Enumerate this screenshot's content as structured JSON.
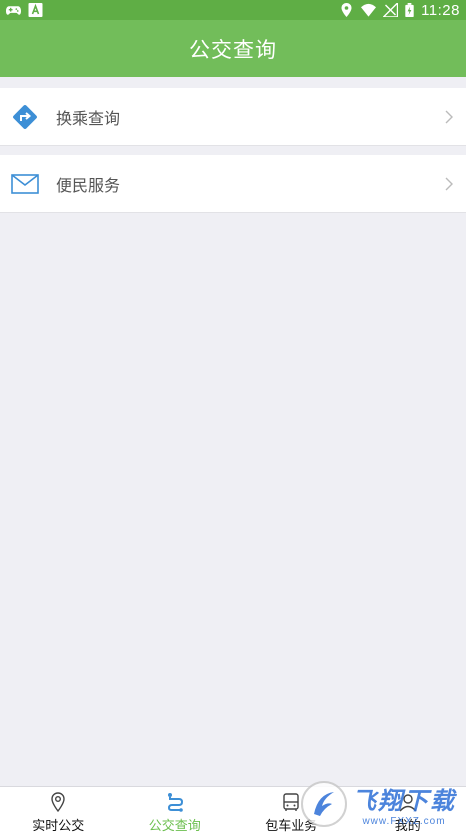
{
  "status_bar": {
    "time": "11:28",
    "left_icons": [
      "gamepad-icon",
      "font-a-icon"
    ],
    "right_icons": [
      "location-icon",
      "wifi-icon",
      "no-signal-icon",
      "battery-icon"
    ]
  },
  "header": {
    "title": "公交查询"
  },
  "menu": {
    "items": [
      {
        "label": "换乘查询",
        "icon": "transfer-route-icon"
      },
      {
        "label": "便民服务",
        "icon": "mail-icon"
      }
    ]
  },
  "tabs": [
    {
      "label": "实时公交",
      "icon": "location-pin-icon",
      "active": false
    },
    {
      "label": "公交查询",
      "icon": "route-icon",
      "active": true
    },
    {
      "label": "包车业务",
      "icon": "bus-icon",
      "active": false
    },
    {
      "label": "我的",
      "icon": "user-icon",
      "active": false
    }
  ],
  "watermark": {
    "title": "飞翔下载",
    "subtitle": "www.FXXZ.com"
  },
  "colors": {
    "header_bg": "#72bd5a",
    "status_bg": "#5fae45",
    "accent_active": "#6cbf4f",
    "icon_blue": "#3d8fd6",
    "page_bg": "#efeff4"
  }
}
